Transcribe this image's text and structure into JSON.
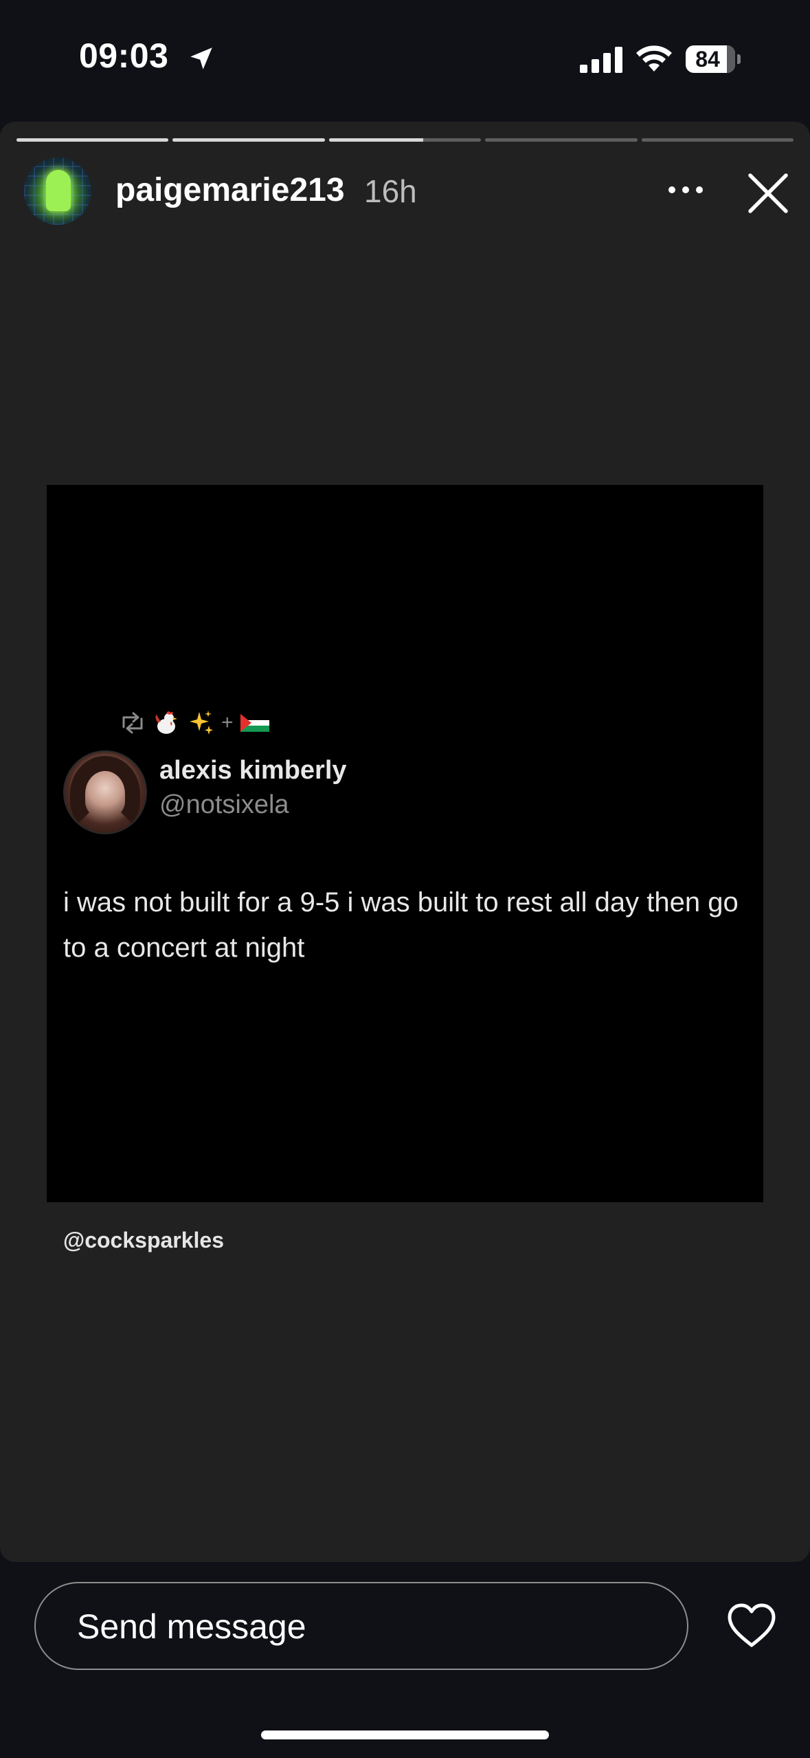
{
  "status_bar": {
    "time": "09:03",
    "battery_level": "84",
    "battery_fraction": 0.84,
    "icons": [
      "location-arrow-icon",
      "cellular-signal-icon",
      "wifi-icon",
      "battery-icon"
    ]
  },
  "story": {
    "username": "paigemarie213",
    "time_ago": "16h",
    "progress": {
      "segments": 5,
      "current_segment": 3,
      "current_fraction": 0.62
    },
    "icons": [
      "more-options-icon",
      "close-icon"
    ]
  },
  "post": {
    "author": "alexis kimberly",
    "handle": "@notsixela",
    "text": "i was not built for a 9-5 i was built to rest all day then go to a concert at night",
    "repost_plus": "+",
    "icons": [
      "repost-icon",
      "rooster-emoji-icon",
      "sparkles-emoji-icon",
      "palestine-flag-icon"
    ]
  },
  "mention": "@cocksparkles",
  "reply": {
    "placeholder": "Send message",
    "icons": [
      "heart-icon"
    ]
  }
}
